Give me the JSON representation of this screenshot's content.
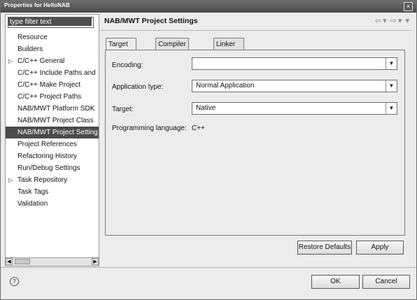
{
  "window": {
    "title": "Properties for HelloNAB",
    "close_glyph": "×"
  },
  "filter": {
    "placeholder": "type filter text"
  },
  "tree": {
    "items": [
      {
        "label": "Resource",
        "expandable": false,
        "selected": false
      },
      {
        "label": "Builders",
        "expandable": false,
        "selected": false
      },
      {
        "label": "C/C++ General",
        "expandable": true,
        "selected": false
      },
      {
        "label": "C/C++ Include Paths and",
        "expandable": false,
        "selected": false
      },
      {
        "label": "C/C++ Make Project",
        "expandable": false,
        "selected": false
      },
      {
        "label": "C/C++ Project Paths",
        "expandable": false,
        "selected": false
      },
      {
        "label": "NAB/MWT Platform SDK",
        "expandable": false,
        "selected": false
      },
      {
        "label": "NAB/MWT Project Class",
        "expandable": false,
        "selected": false
      },
      {
        "label": "NAB/MWT Project Setting",
        "expandable": false,
        "selected": true
      },
      {
        "label": "Project References",
        "expandable": false,
        "selected": false
      },
      {
        "label": "Refactoring History",
        "expandable": false,
        "selected": false
      },
      {
        "label": "Run/Debug Settings",
        "expandable": false,
        "selected": false
      },
      {
        "label": "Task Repository",
        "expandable": true,
        "selected": false
      },
      {
        "label": "Task Tags",
        "expandable": false,
        "selected": false
      },
      {
        "label": "Validation",
        "expandable": false,
        "selected": false
      }
    ],
    "expand_glyph": "▷",
    "scroll_left": "◀",
    "scroll_right": "▶"
  },
  "page": {
    "title": "NAB/MWT Project Settings",
    "nav_back": "⇦",
    "nav_forward": "⇨",
    "nav_menu": "▾"
  },
  "tabs": [
    {
      "label": "Target Settings",
      "active": true
    },
    {
      "label": "Compiler Settings",
      "active": false
    },
    {
      "label": "Linker Settings",
      "active": false
    }
  ],
  "form": {
    "encoding": {
      "label": "Encoding:",
      "value": ""
    },
    "application_type": {
      "label": "Application type:",
      "value": "Normal Application"
    },
    "target": {
      "label": "Target:",
      "value": "Native"
    },
    "programming_language": {
      "label": "Programming language:",
      "value": "C++"
    },
    "dropdown_glyph": "▼"
  },
  "buttons": {
    "restore_defaults": "Restore Defaults",
    "apply": "Apply",
    "ok": "OK",
    "cancel": "Cancel"
  },
  "help": {
    "glyph": "?"
  }
}
